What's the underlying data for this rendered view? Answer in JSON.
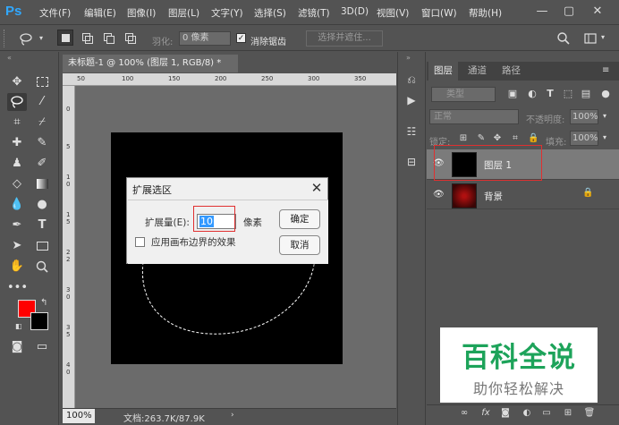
{
  "app": {
    "logo": "Ps"
  },
  "menu": [
    "文件(F)",
    "编辑(E)",
    "图像(I)",
    "图层(L)",
    "文字(Y)",
    "选择(S)",
    "滤镜(T)",
    "3D(D)",
    "视图(V)",
    "窗口(W)",
    "帮助(H)"
  ],
  "window": {
    "minimize": "—",
    "maximize": "▢",
    "close": "✕"
  },
  "options": {
    "feather_label": "羽化:",
    "feather_value": "0 像素",
    "antialias_label": "消除锯齿",
    "antialias_checked": true,
    "select_mask_button": "选择并遮住..."
  },
  "document": {
    "tab_title": "未标题-1 @ 100% (图层 1, RGB/8) *",
    "ruler_h": [
      "50",
      "100",
      "150",
      "200",
      "250",
      "300",
      "350"
    ],
    "ruler_v": [
      "0",
      "5",
      "1",
      "0",
      "1",
      "5",
      "2",
      "2",
      "3",
      "0",
      "3",
      "5",
      "4",
      "0"
    ],
    "zoom": "100%",
    "doc_info": "文档:263.7K/87.9K"
  },
  "dialog": {
    "title": "扩展选区",
    "expand_label": "扩展量(E):",
    "expand_value": "10",
    "unit": "像素",
    "ok": "确定",
    "cancel": "取消",
    "edge_effect_label": "应用画布边界的效果",
    "edge_effect_checked": false
  },
  "layers_panel": {
    "tabs": [
      "图层",
      "通道",
      "路径"
    ],
    "active_tab": "图层",
    "kind_filter": "类型",
    "blend_mode": "正常",
    "opacity_label": "不透明度:",
    "opacity_value": "100%",
    "lock_label": "锁定:",
    "fill_label": "填充:",
    "fill_value": "100%",
    "layers": [
      {
        "name": "图层 1",
        "selected": true
      },
      {
        "name": "背景",
        "locked": true
      }
    ]
  },
  "watermark": {
    "title": "百科全说",
    "subtitle": "助你轻松解决"
  },
  "colors": {
    "foreground": "#ff0000",
    "background": "#000000",
    "accent": "#31a8ff"
  }
}
